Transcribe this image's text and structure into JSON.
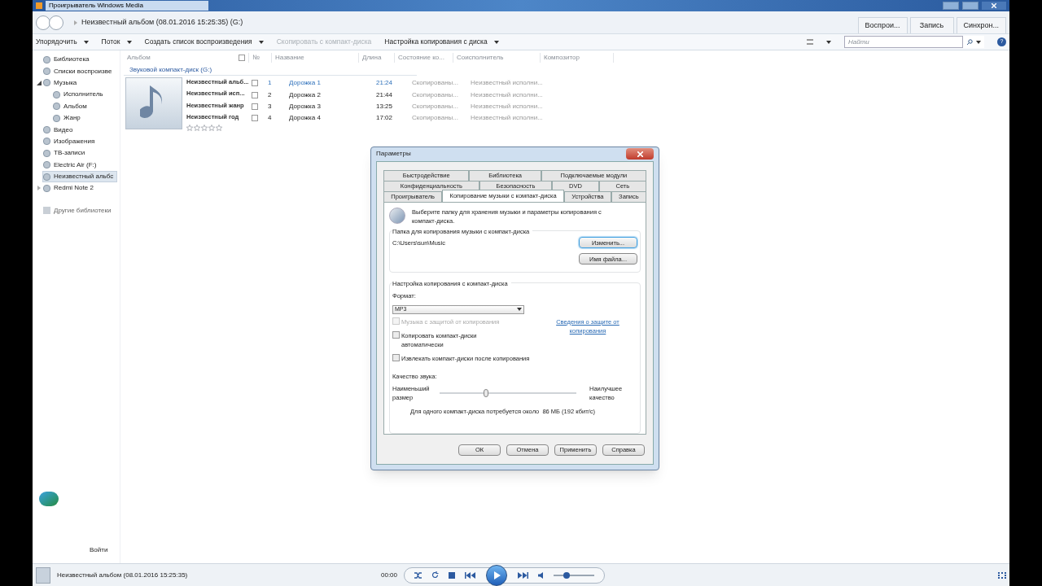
{
  "window": {
    "title": "Проигрыватель Windows Media"
  },
  "nav": {
    "breadcrumb": "Неизвестный альбом (08.01.2016 15:25:35) (G:)",
    "tabs": [
      {
        "label": "Воспрои...",
        "selected": false
      },
      {
        "label": "Запись",
        "selected": false
      },
      {
        "label": "Синхрон...",
        "selected": false
      }
    ]
  },
  "toolbar": {
    "items": [
      {
        "label": "Упорядочить",
        "disabled": false
      },
      {
        "label": "Поток",
        "disabled": false
      },
      {
        "label": "Создать список воспроизведения",
        "disabled": false
      },
      {
        "label": "Скопировать с компакт-диска",
        "disabled": true
      },
      {
        "label": "Настройка копирования с диска",
        "disabled": false
      }
    ],
    "search": {
      "placeholder": "Найти"
    },
    "help": "?"
  },
  "sidebar": {
    "items": [
      {
        "label": "Библиотека",
        "selected": false
      },
      {
        "label": "Списки воспроизве",
        "selected": false
      },
      {
        "label": "Музыка",
        "selected": false,
        "expanded": true,
        "children": [
          {
            "label": "Исполнитель",
            "selected": false
          },
          {
            "label": "Альбом",
            "selected": false
          },
          {
            "label": "Жанр",
            "selected": false
          }
        ]
      },
      {
        "label": "Видео",
        "selected": false
      },
      {
        "label": "Изображения",
        "selected": false
      },
      {
        "label": "ТВ-записи",
        "selected": false
      },
      {
        "label": "Electric Air (F:)",
        "selected": false
      },
      {
        "label": "Неизвестный альбс",
        "selected": true
      },
      {
        "label": "Redmi Note 2",
        "selected": false,
        "expanded": false
      }
    ],
    "other": "Другие библиотеки",
    "signin": "Войти"
  },
  "table": {
    "columns": [
      "Альбом",
      "№",
      "Название",
      "Длина",
      "Состояние ко...",
      "Соисполнитель",
      "Композитор"
    ],
    "group": "Звуковой компакт-диск (G:)",
    "select_all_checked": false,
    "album_info": [
      "Неизвестный альб...",
      "Неизвестный исп...",
      "Неизвестный жанр",
      "Неизвестный год"
    ],
    "stars": 0,
    "rows": [
      {
        "num": "1",
        "title": "Дорожка 1",
        "length": "21:24",
        "status": "Скопированы...",
        "artist": "Неизвестный исполни...",
        "selected": true
      },
      {
        "num": "2",
        "title": "Дорожка 2",
        "length": "21:44",
        "status": "Скопированы...",
        "artist": "Неизвестный исполни...",
        "selected": false
      },
      {
        "num": "3",
        "title": "Дорожка 3",
        "length": "13:25",
        "status": "Скопированы...",
        "artist": "Неизвестный исполни...",
        "selected": false
      },
      {
        "num": "4",
        "title": "Дорожка 4",
        "length": "17:02",
        "status": "Скопированы...",
        "artist": "Неизвестный исполни...",
        "selected": false
      }
    ]
  },
  "dialog": {
    "title": "Параметры",
    "tab_rows": [
      [
        {
          "label": "Быстродействие",
          "selected": false
        },
        {
          "label": "Библиотека",
          "selected": false
        },
        {
          "label": "Подключаемые модули",
          "selected": false
        }
      ],
      [
        {
          "label": "Конфиденциальность",
          "selected": false
        },
        {
          "label": "Безопасность",
          "selected": false
        },
        {
          "label": "DVD",
          "selected": false
        },
        {
          "label": "Сеть",
          "selected": false
        }
      ],
      [
        {
          "label": "Проигрыватель",
          "selected": false
        },
        {
          "label": "Копирование музыки с компакт-диска",
          "selected": true
        },
        {
          "label": "Устройства",
          "selected": false
        },
        {
          "label": "Запись",
          "selected": false
        }
      ]
    ],
    "intro": "Выберите папку для хранения музыки и параметры копирования с компакт-диска.",
    "folder_group": "Папка для копирования музыки с компакт-диска",
    "folder_path": "C:\\Users\\sun\\Music",
    "folder_buttons": [
      {
        "label": "Изменить...",
        "focused": true
      },
      {
        "label": "Имя файла...",
        "focused": false
      }
    ],
    "rip_group": "Настройка копирования с компакт-диска",
    "format_label": "Формат:",
    "format_value": "MP3",
    "checkboxes": [
      {
        "label": "Музыка с защитой от копирования",
        "checked": false,
        "disabled": true
      },
      {
        "label": "Копировать компакт-диски автоматически",
        "checked": false,
        "disabled": false
      },
      {
        "label": "Извлекать компакт-диски после копирования",
        "checked": false,
        "disabled": false
      }
    ],
    "link": "Сведения о защите от копирования",
    "quality_label": "Качество звука:",
    "quality_min": "Наименьший размер",
    "quality_max": "Наилучшее качество",
    "level": 0.34,
    "quality_info": "Для одного компакт-диска потребуется около  86 МБ (192 кбит/с)",
    "buttons": [
      "ОК",
      "Отмена",
      "Применить",
      "Справка"
    ]
  },
  "player": {
    "now_playing": "Неизвестный альбом (08.01.2016 15:25:35)",
    "time": "00:00",
    "volume": {
      "level": 0.32
    }
  }
}
